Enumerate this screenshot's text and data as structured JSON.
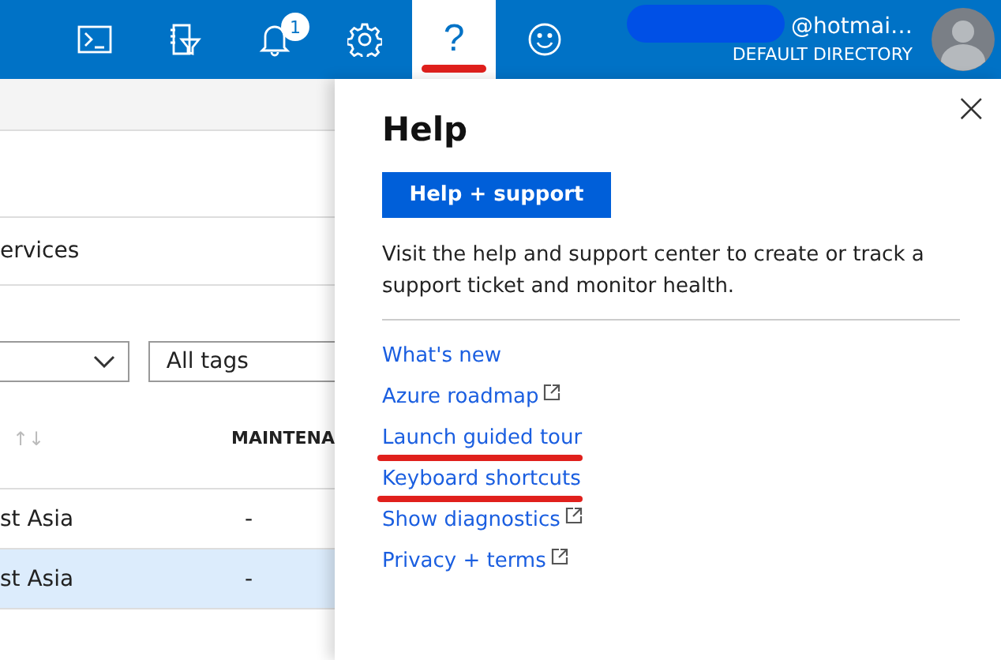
{
  "topbar": {
    "icons": [
      {
        "kind": "shell",
        "selected": false,
        "marked": false
      },
      {
        "kind": "filter",
        "selected": false,
        "marked": false
      },
      {
        "kind": "bell",
        "selected": false,
        "marked": false,
        "badge": "1"
      },
      {
        "kind": "gear",
        "selected": false,
        "marked": false
      },
      {
        "kind": "help",
        "selected": true,
        "marked": true,
        "glyph": "?"
      },
      {
        "kind": "smiley",
        "selected": false,
        "marked": false
      }
    ],
    "account": {
      "email": "@hotmai…",
      "directory": "DEFAULT DIRECTORY",
      "redacted": true
    }
  },
  "background": {
    "tab_text": "ervices",
    "tags_field": {
      "value": "All tags"
    },
    "table": {
      "sort_glyph": "↑↓",
      "columns": [
        "MAINTENA"
      ],
      "rows": [
        {
          "location": "st Asia",
          "maintenance": "-",
          "selected": false
        },
        {
          "location": "st Asia",
          "maintenance": "-",
          "selected": true
        }
      ]
    }
  },
  "help_panel": {
    "title": "Help",
    "close_glyph": "×",
    "button": "Help + support",
    "description": "Visit the help and support center to create or track a support ticket and monitor health.",
    "links": [
      {
        "label": "What's new",
        "external": false,
        "marked": false
      },
      {
        "label": "Azure roadmap",
        "external": true,
        "marked": false
      },
      {
        "label": "Launch guided tour",
        "external": false,
        "marked": true
      },
      {
        "label": "Keyboard shortcuts",
        "external": false,
        "marked": true
      },
      {
        "label": "Show diagnostics",
        "external": true,
        "marked": false
      },
      {
        "label": "Privacy + terms",
        "external": true,
        "marked": false
      }
    ]
  }
}
